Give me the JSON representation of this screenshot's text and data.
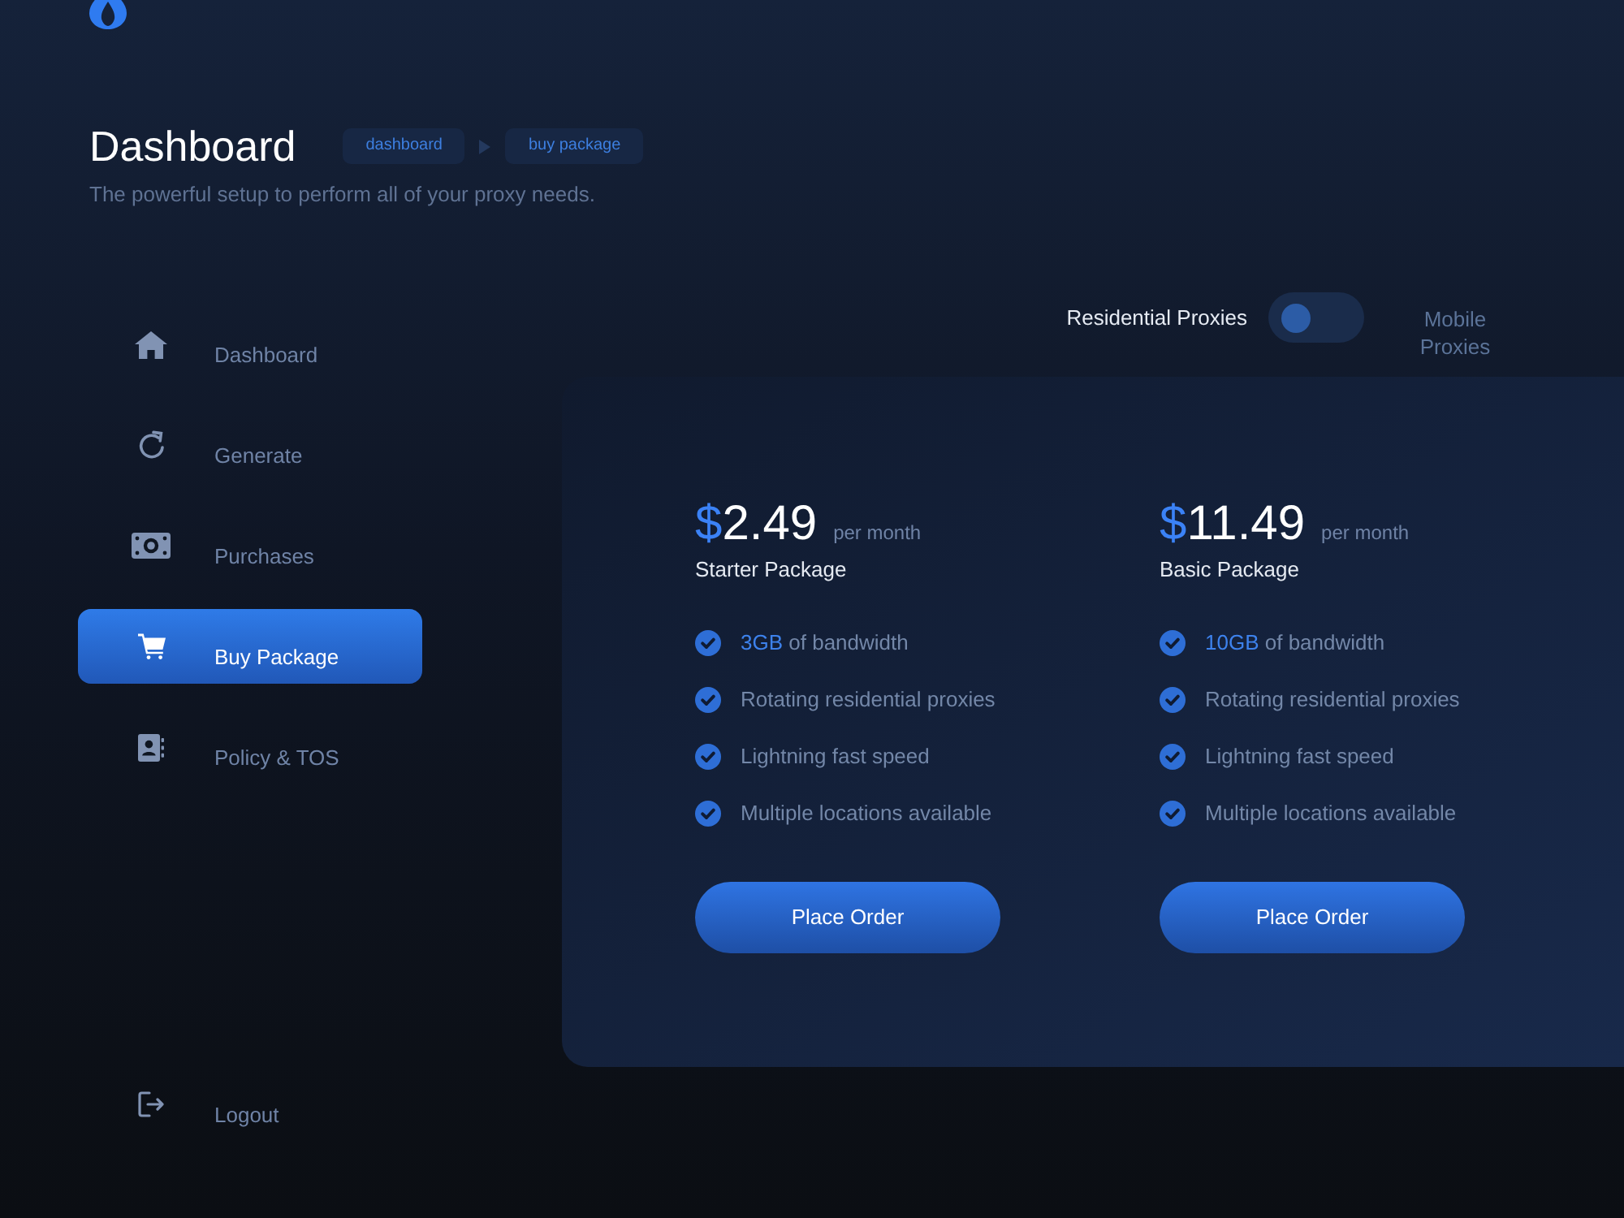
{
  "header": {
    "title": "Dashboard",
    "breadcrumbs": [
      "dashboard",
      "buy package"
    ],
    "subtitle": "The powerful setup to perform all of your proxy needs."
  },
  "sidebar": {
    "items": [
      {
        "label": "Dashboard",
        "selected": false
      },
      {
        "label": "Generate",
        "selected": false
      },
      {
        "label": "Purchases",
        "selected": false
      },
      {
        "label": "Buy Package",
        "selected": true
      },
      {
        "label": "Policy & TOS",
        "selected": false
      }
    ],
    "logout": {
      "label": "Logout"
    }
  },
  "proxy_toggle": {
    "left_label": "Residential Proxies",
    "right_label": "Mobile Proxies",
    "on": false
  },
  "packages": [
    {
      "currency": "$",
      "amount": "2.49",
      "period": "per month",
      "name": "Starter Package",
      "features": [
        {
          "accent": "3GB",
          "text": "of bandwidth"
        },
        {
          "text": "Rotating residential proxies"
        },
        {
          "text": "Lightning fast speed"
        },
        {
          "text": "Multiple locations available"
        }
      ],
      "button": "Place Order"
    },
    {
      "currency": "$",
      "amount": "11.49",
      "period": "per month",
      "name": "Basic Package",
      "features": [
        {
          "accent": "10GB",
          "text": "of bandwidth"
        },
        {
          "text": "Rotating residential proxies"
        },
        {
          "text": "Lightning fast speed"
        },
        {
          "text": "Multiple locations available"
        }
      ],
      "button": "Place Order"
    }
  ]
}
